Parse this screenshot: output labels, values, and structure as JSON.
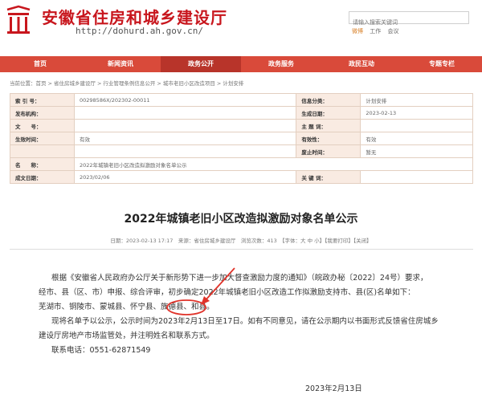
{
  "header": {
    "site_title": "安徽省住房和城乡建设厅",
    "site_url": "http://dohurd.ah.gov.cn/",
    "search_placeholder": "请输入搜索关键词",
    "links": [
      "微博",
      "工作",
      "会议"
    ],
    "brand_color": "#c8161d"
  },
  "nav": {
    "items": [
      "首页",
      "新闻资讯",
      "政务公开",
      "政务服务",
      "政民互动",
      "专题专栏"
    ],
    "active_index": 2,
    "color": "#d94a3a"
  },
  "breadcrumb": {
    "items": [
      "当前位置：首页",
      "省住房城乡建设厅",
      "行业管理条例信息公开",
      "城市老旧小区改造项目",
      "计划安排"
    ]
  },
  "info": {
    "rows": [
      {
        "l1": "索 引 号：",
        "v1": "002985​86X/202302-00011",
        "l2": "信息分类：",
        "v2": "计划安排"
      },
      {
        "l1": "发布机构：",
        "v1": "",
        "l2": "生成日期：",
        "v2": "2023-02-13"
      },
      {
        "l1": "文　　号：",
        "v1": "",
        "l2": "主 题 词：",
        "v2": ""
      },
      {
        "l1": "生效时间：",
        "v1": "有效",
        "l2": "有效性：",
        "v2": "有效"
      },
      {
        "l1": "",
        "v1": "",
        "l2": "废止时间：",
        "v2": "暂无"
      },
      {
        "l1": "名　　称：",
        "v1": "2022年城镇老旧小区改造拟激励对象名单公示",
        "l2": "",
        "v2": ""
      },
      {
        "l1": "成文日期：",
        "v1": "2023/02/06",
        "l2": "关 键 词：",
        "v2": ""
      }
    ]
  },
  "article": {
    "title": "2022年城镇老旧小区改造拟激励对象名单公示",
    "meta": "日期：2023-02-13 17:17　来源：省住房城乡建设厅　浏览次数：413　【字体：大 中 小】【我要打印】【关闭】",
    "p1a": "根据《安徽省人民政府办公厅关于新形势下进一步加大督查激励力度的通知》（皖政办秘〔2022〕24号）要求，",
    "p1b": "经市、县（区、市）申报、综合评审，初步确定2022年城镇老旧小区改造工作拟激励支持市、县(区)名单如下：",
    "p2_pre": "芜湖市、铜陵市、蒙城县、怀宁县、",
    "p2_highlight": "旌德县",
    "p2_post": "、和县。",
    "p3a": "现将名单予以公示，公示时间为2023年2月13日至17日。如有不同意见，请在公示期内以书面形式反馈省住房城乡",
    "p3b": "建设厅房地产市场监管处，并注明姓名和联系方式。",
    "p4": "联系电话：0551-62871549",
    "date": "2023年2月13日"
  },
  "annotation": {
    "color": "#e0332a"
  }
}
